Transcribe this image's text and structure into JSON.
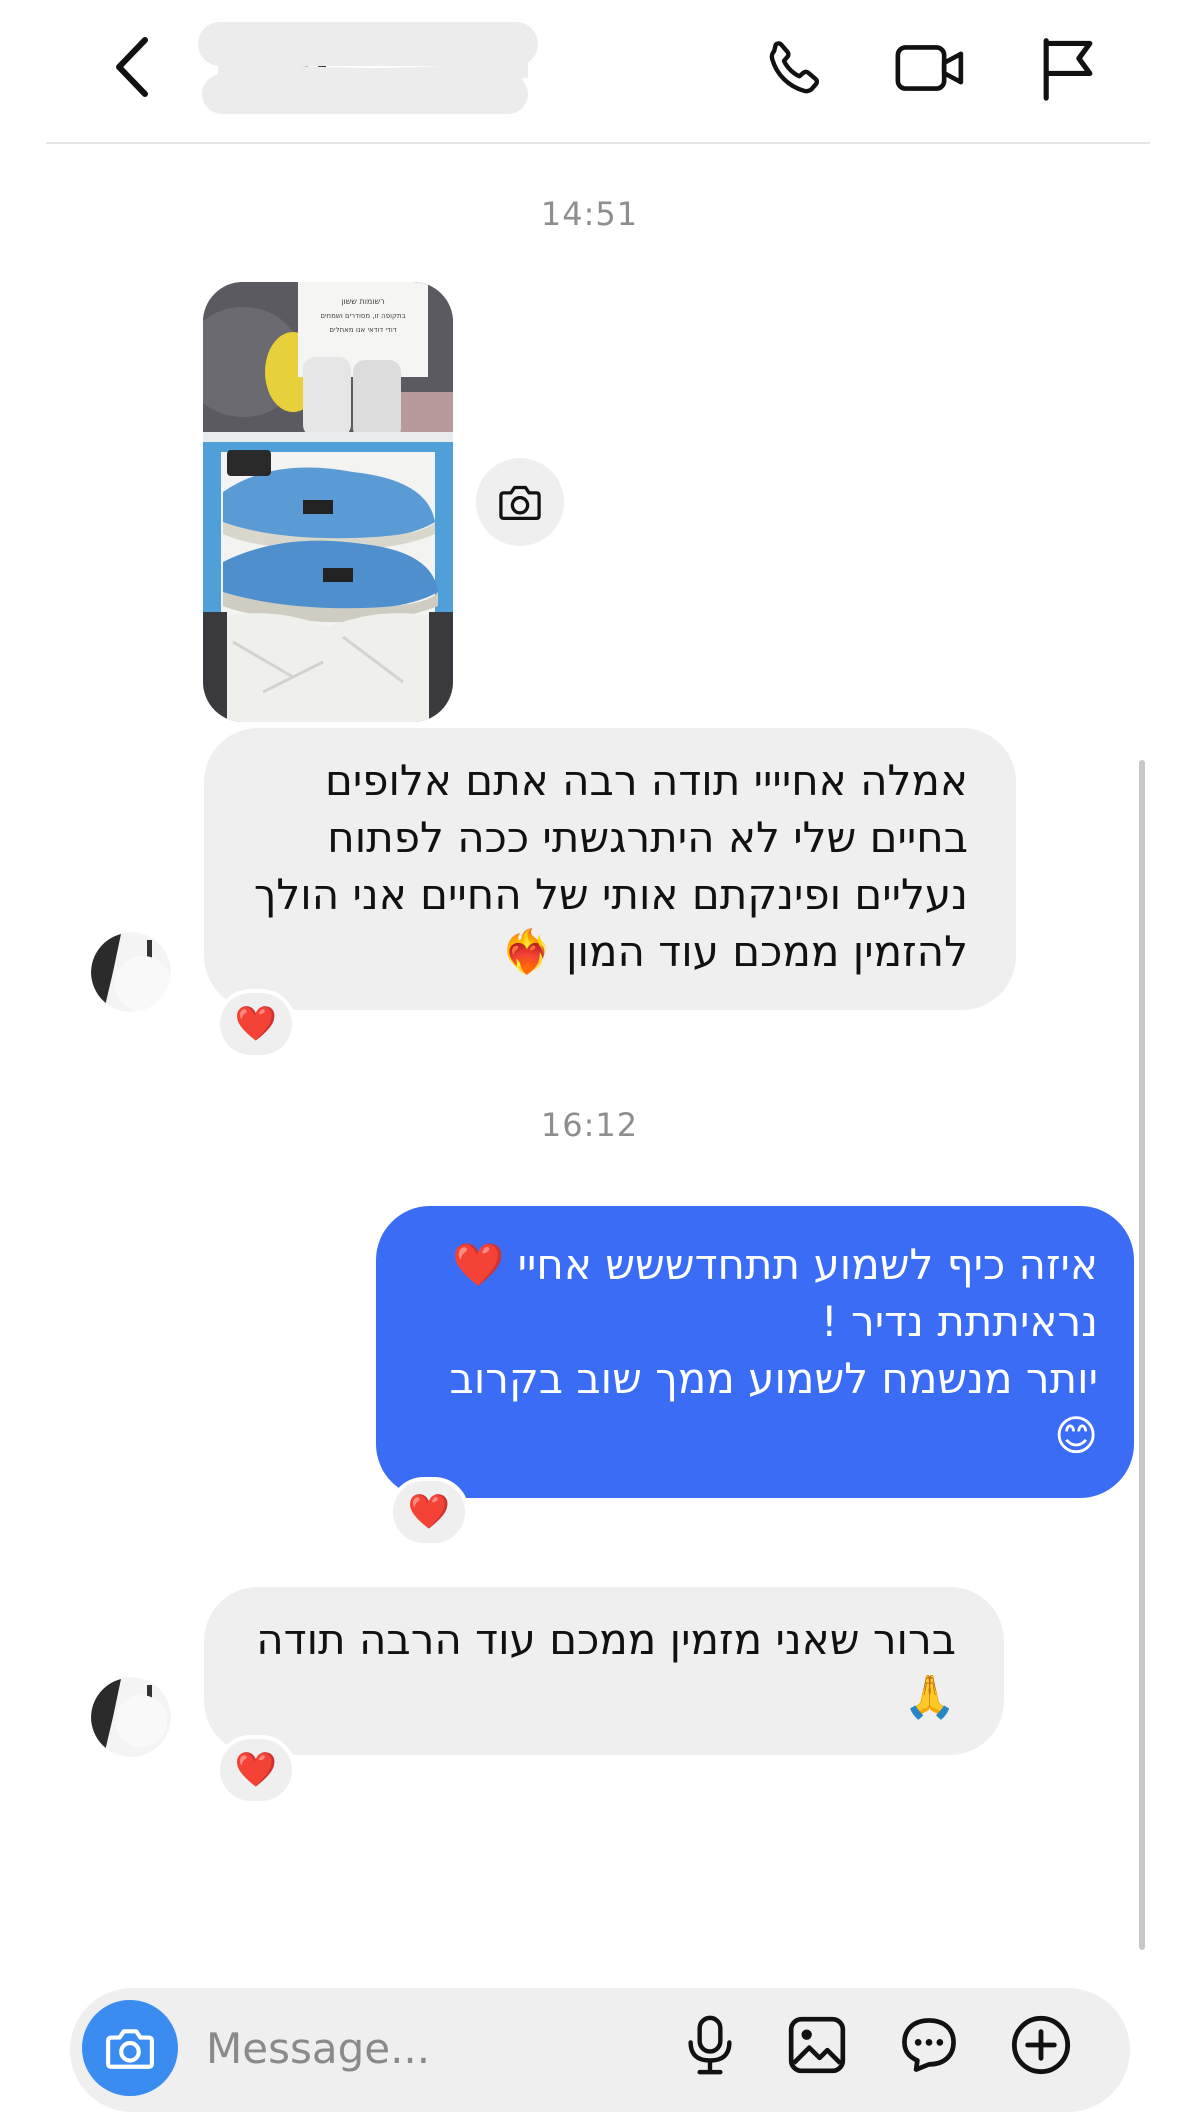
{
  "header": {
    "contact_name_redacted": true,
    "icons": {
      "back": "chevron-left-icon",
      "call": "phone-icon",
      "video": "video-camera-icon",
      "flag": "flag-icon"
    }
  },
  "timestamps": [
    "14:51",
    "16:12"
  ],
  "messages": [
    {
      "direction": "incoming",
      "type": "photo",
      "photo_note_lines": [
        "רשומות ששון",
        "בתקופה זו, מסודרים ושמחים",
        "דודי דודאי אנו מאחלים"
      ],
      "action_icon": "camera-icon"
    },
    {
      "direction": "incoming",
      "lines": [
        "אמלה  אחיייי תודה רבה אתם אלופים",
        "בחיים שלי לא היתרגשתי ככה לפתוח",
        "נעליים ופינקתם אותי של החיים אני הולך",
        "להזמין ממכם עוד המון ❤️‍🔥"
      ],
      "reaction": "❤️"
    },
    {
      "direction": "outgoing",
      "lines": [
        "איזה כיף לשמוע תתחדששש אחיי ❤️",
        "נראיתתת נדיר  !",
        "יותר מנשמח לשמוע ממך שוב בקרוב",
        "😊"
      ],
      "reaction": "❤️"
    },
    {
      "direction": "incoming",
      "lines": [
        "ברור שאני מזמין ממכם עוד הרבה תודה",
        "🙏"
      ],
      "reaction": "❤️"
    }
  ],
  "composer": {
    "placeholder": "Message...",
    "icons": [
      "camera-icon",
      "microphone-icon",
      "image-gallery-icon",
      "sticker-chat-icon",
      "plus-circle-icon"
    ]
  },
  "colors": {
    "outgoing_bubble": "#3a6cf5",
    "incoming_bubble": "#efefef",
    "camera_button": "#3a8cf0",
    "timestamp": "#8e8e8e"
  }
}
